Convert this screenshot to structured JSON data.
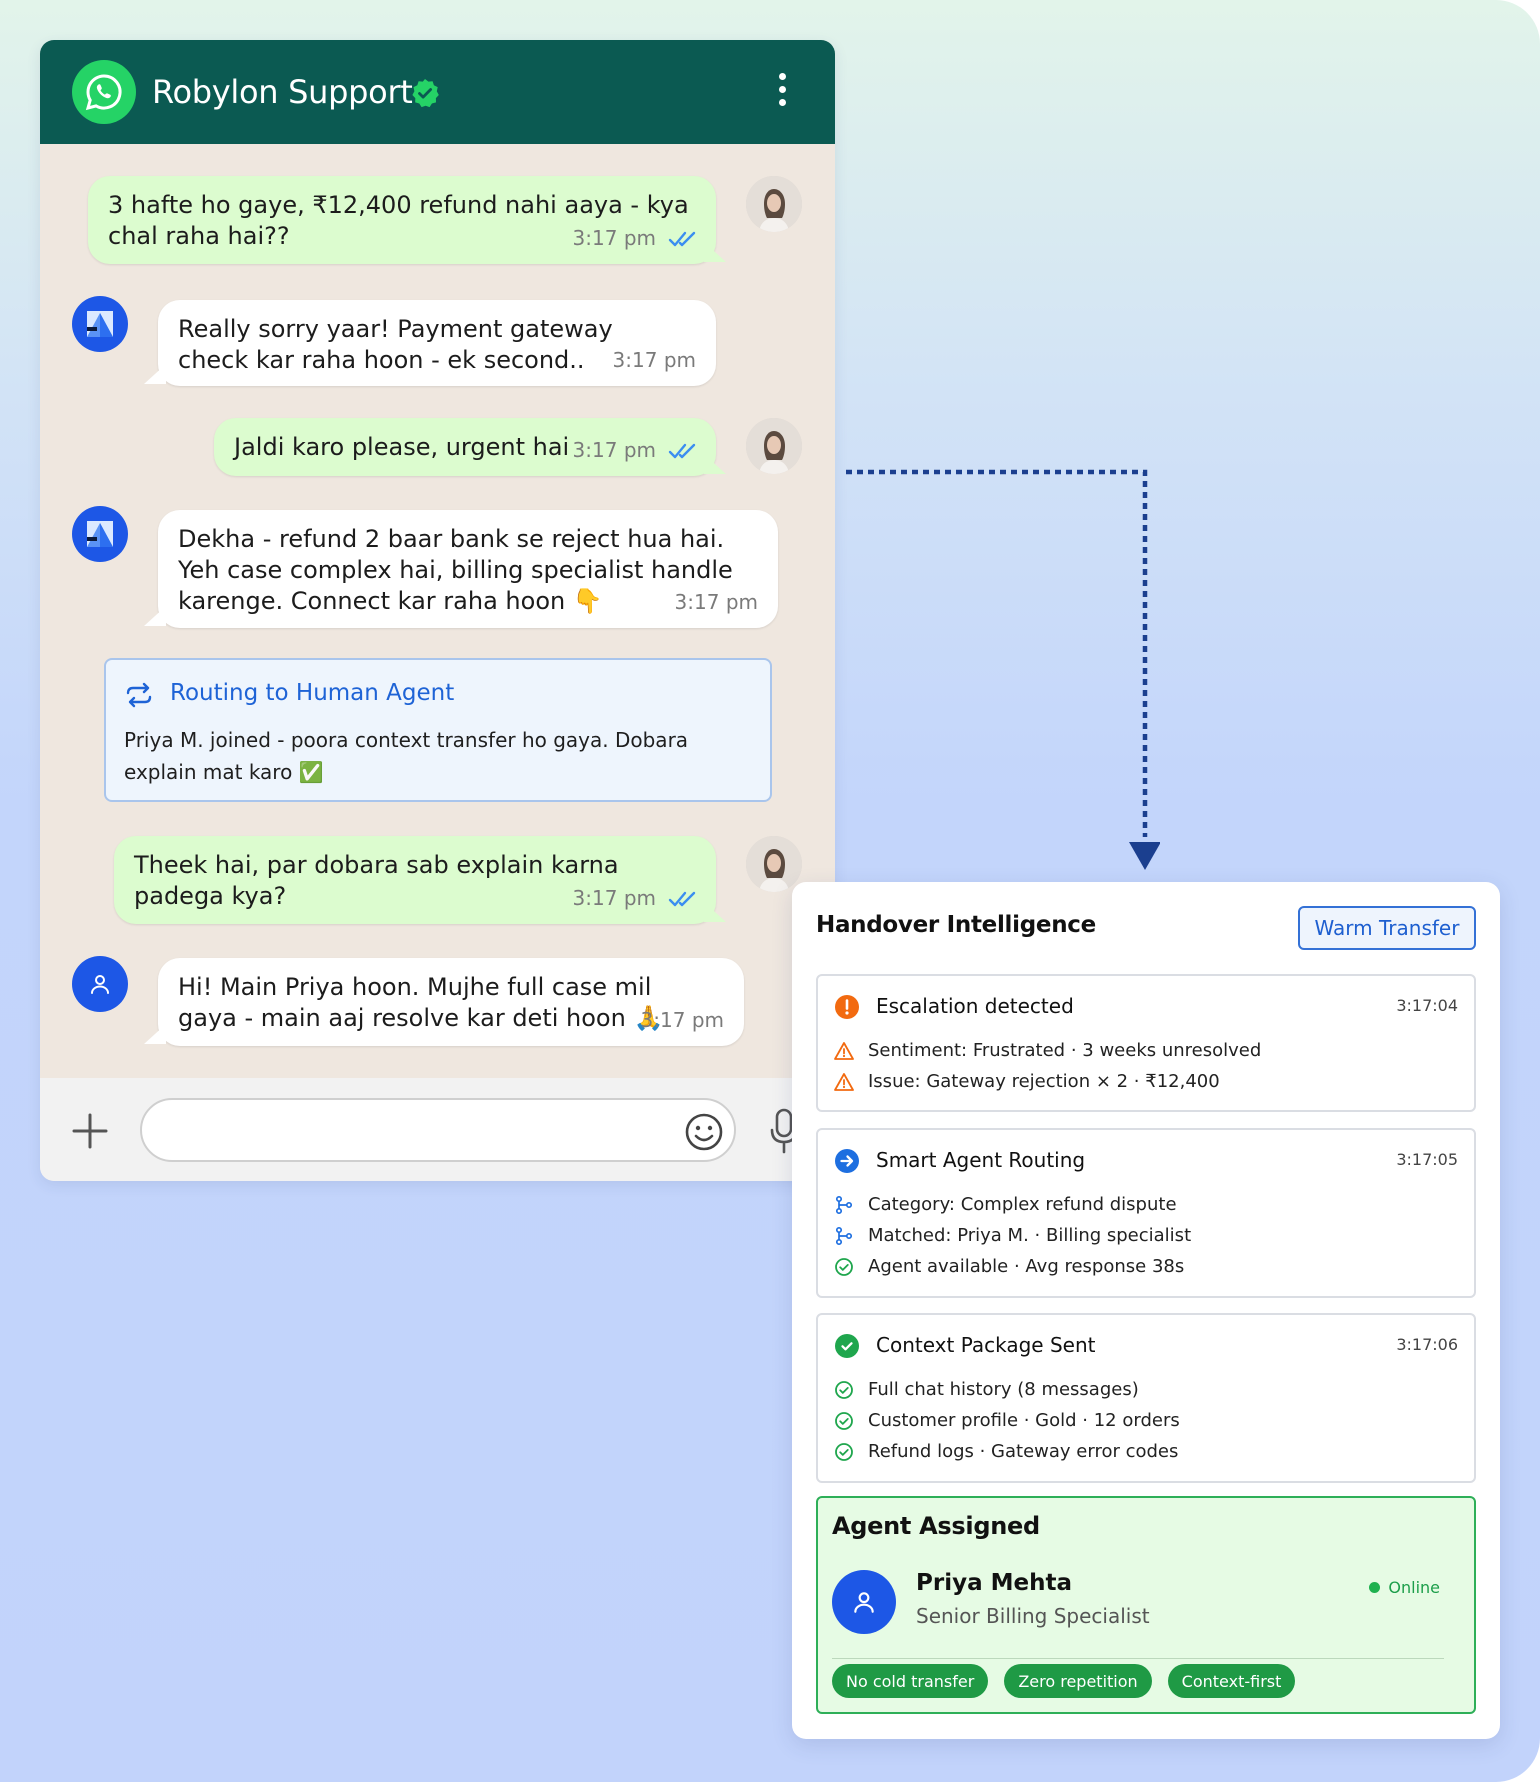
{
  "chat": {
    "title": "Robylon Support",
    "messages": [
      {
        "text": "3 hafte ho gaye, ₹12,400 refund nahi aaya - kya chal raha hai??",
        "time": "3:17 pm",
        "sender": "user"
      },
      {
        "text": "Really sorry yaar! Payment gateway check kar raha hoon - ek second..",
        "time": "3:17 pm",
        "sender": "bot"
      },
      {
        "text": "Jaldi karo please, urgent hai",
        "time": "3:17 pm",
        "sender": "user"
      },
      {
        "text": "Dekha - refund 2 baar bank se reject hua hai. Yeh case complex hai, billing specialist handle karenge. Connect kar raha hoon 👇",
        "time": "3:17 pm",
        "sender": "bot"
      },
      {
        "text": "Theek hai, par dobara sab explain karna padega kya?",
        "time": "3:17 pm",
        "sender": "user"
      },
      {
        "text": "Hi! Main Priya hoon. Mujhe full case mil gaya - main aaj resolve kar deti hoon 🙏",
        "time": "3:17 pm",
        "sender": "agent"
      }
    ],
    "routing": {
      "title": "Routing to Human Agent",
      "text": "Priya M. joined - poora context transfer ho gaya. Dobara explain mat karo ✅"
    },
    "composer": {
      "placeholder": ""
    }
  },
  "panel": {
    "title": "Handover Intelligence",
    "button": "Warm Transfer",
    "steps": [
      {
        "title": "Escalation detected",
        "time": "3:17:04",
        "icon": "alert-circle-icon",
        "color": "#f26a10",
        "items": [
          {
            "icon": "warning-triangle-icon",
            "text": "Sentiment: Frustrated · 3 weeks unresolved"
          },
          {
            "icon": "warning-triangle-icon",
            "text": "Issue: Gateway rejection × 2 · ₹12,400"
          }
        ]
      },
      {
        "title": "Smart Agent Routing",
        "time": "3:17:05",
        "icon": "arrow-right-circle-icon",
        "color": "#1e6fe0",
        "items": [
          {
            "icon": "branch-icon",
            "text": "Category: Complex refund dispute"
          },
          {
            "icon": "branch-icon",
            "text": "Matched: Priya M. · Billing specialist"
          },
          {
            "icon": "check-circle-icon",
            "text": "Agent available · Avg response 38s"
          }
        ]
      },
      {
        "title": "Context Package Sent",
        "time": "3:17:06",
        "icon": "check-filled-icon",
        "color": "#1fa64d",
        "items": [
          {
            "icon": "check-circle-icon",
            "text": "Full chat history (8 messages)"
          },
          {
            "icon": "check-circle-icon",
            "text": "Customer profile · Gold · 12 orders"
          },
          {
            "icon": "check-circle-icon",
            "text": "Refund logs · Gateway error codes"
          }
        ]
      }
    ],
    "assigned": {
      "title": "Agent Assigned",
      "name": "Priya Mehta",
      "role": "Senior Billing Specialist",
      "status": "Online",
      "tags": [
        "No cold transfer",
        "Zero repetition",
        "Context-first"
      ]
    }
  },
  "colors": {
    "header": "#0b5a52",
    "outgoing": "#dcfccf",
    "accent": "#1e63d6",
    "success": "#1f9a45"
  }
}
